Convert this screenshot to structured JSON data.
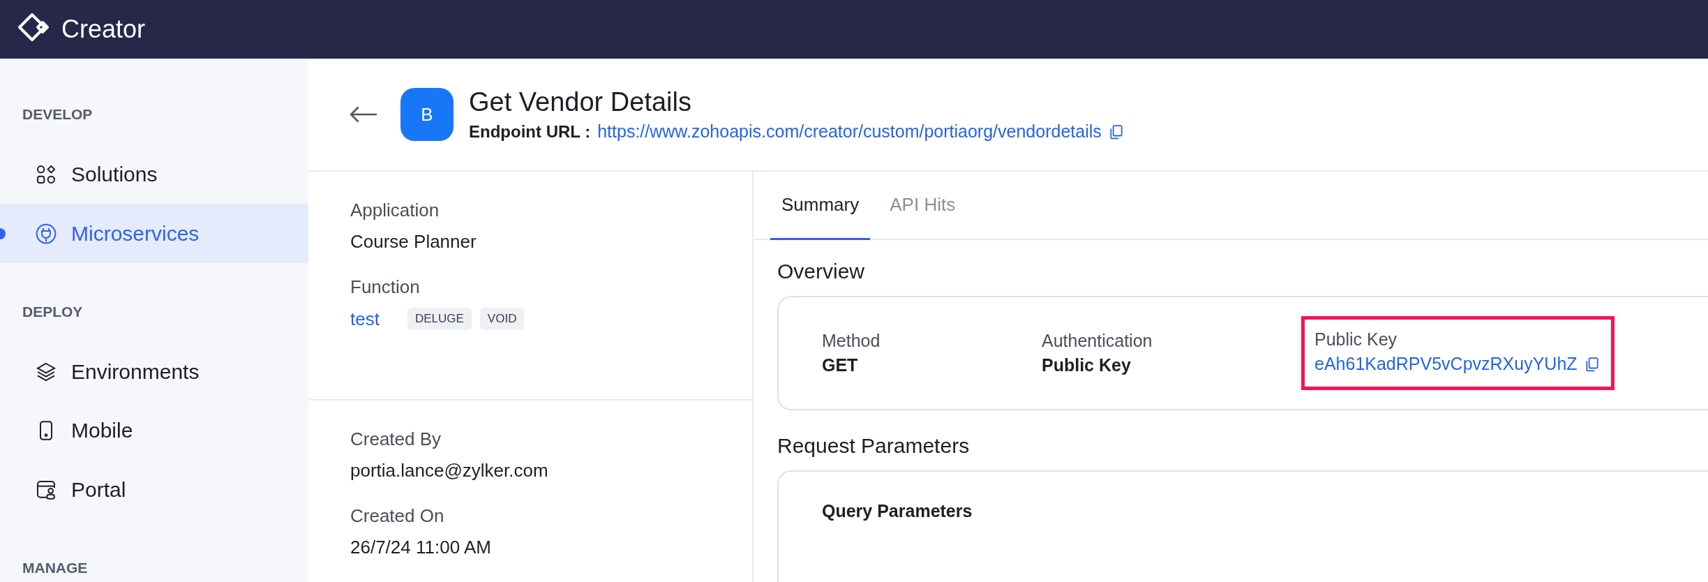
{
  "app": {
    "name": "Creator"
  },
  "sidebar": {
    "sections": [
      {
        "title": "DEVELOP",
        "items": [
          {
            "label": "Solutions",
            "selected": false
          },
          {
            "label": "Microservices",
            "selected": true
          }
        ]
      },
      {
        "title": "DEPLOY",
        "items": [
          {
            "label": "Environments",
            "selected": false
          },
          {
            "label": "Mobile",
            "selected": false
          },
          {
            "label": "Portal",
            "selected": false
          }
        ]
      },
      {
        "title": "MANAGE"
      }
    ]
  },
  "page_header": {
    "avatar": "B",
    "title": "Get Vendor Details",
    "endpoint_label": "Endpoint URL :",
    "endpoint_url": "https://www.zohoapis.com/creator/custom/portiaorg/vendordetails"
  },
  "details": [
    [
      {
        "label": "Application",
        "value": "Course Planner",
        "kind": "text"
      },
      {
        "label": "Function",
        "value": "test",
        "kind": "link",
        "tags": [
          "DELUGE",
          "VOID"
        ]
      }
    ],
    [
      {
        "label": "Created By",
        "value": "portia.lance@zylker.com",
        "kind": "text"
      },
      {
        "label": "Created On",
        "value": "26/7/24 11:00 AM",
        "kind": "text"
      }
    ]
  ],
  "tabs": [
    {
      "label": "Summary",
      "selected": true
    },
    {
      "label": "API Hits",
      "selected": false
    }
  ],
  "overview": {
    "title": "Overview",
    "fields": [
      {
        "label": "Method",
        "value": "GET",
        "kind": "text",
        "highlighted": false
      },
      {
        "label": "Authentication",
        "value": "Public Key",
        "kind": "text",
        "highlighted": false
      },
      {
        "label": "Public Key",
        "value": "eAh61KadRPV5vCpvzRXuyYUhZ",
        "kind": "copy",
        "highlighted": true
      }
    ]
  },
  "request_parameters": {
    "title": "Request Parameters",
    "card_title": "Query Parameters"
  }
}
